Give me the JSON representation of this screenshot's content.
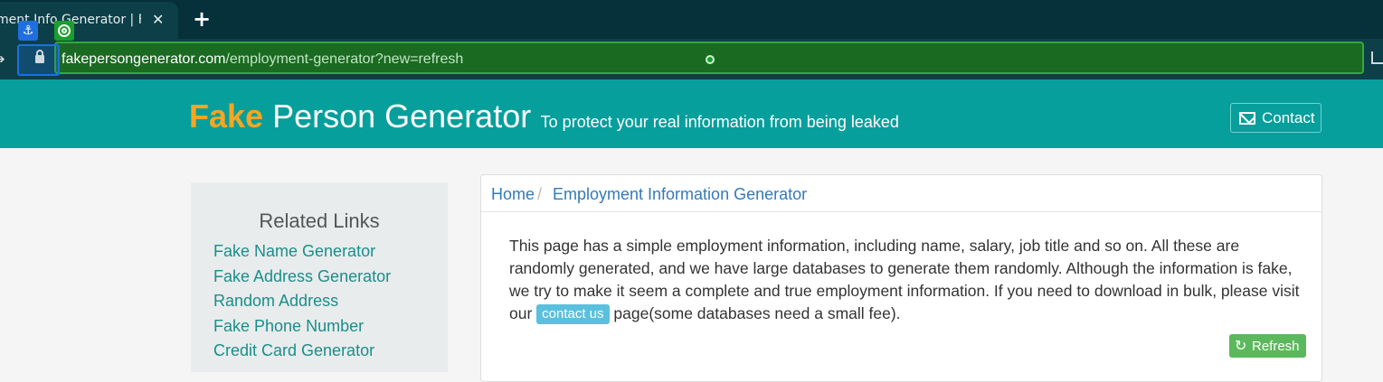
{
  "browser": {
    "tab_title": "ment Info Generator | Fak",
    "tab_close": "✕",
    "new_tab": "+",
    "url_host": "fakepersongenerator.com",
    "url_path": "/employment-generator?new=refresh"
  },
  "site": {
    "brand_fake": "Fake",
    "brand_rest": " Person Generator",
    "tagline": "To protect your real information from being leaked",
    "contact_label": "Contact"
  },
  "sidebar": {
    "title": "Related Links",
    "links": [
      "Fake Name Generator",
      "Fake Address Generator",
      "Random Address",
      "Fake Phone Number",
      "Credit Card Generator"
    ]
  },
  "breadcrumb": {
    "home": "Home",
    "separator": "/",
    "current": "Employment Information Generator"
  },
  "main": {
    "description_before": "This page has a simple employment information, including name, salary, job title and so on. All these are randomly generated, and we have large databases to generate them randomly. Although the information is fake, we try to make it seem a complete and true employment information. If you need to download in bulk, please visit our ",
    "contact_us": "contact us",
    "description_after": " page(some databases need a small fee).",
    "refresh_label": "Refresh"
  },
  "colors": {
    "header_bg": "#079f9c",
    "brand_accent": "#f6a623",
    "link": "#1a8e8b",
    "refresh_bg": "#5cb85c"
  }
}
